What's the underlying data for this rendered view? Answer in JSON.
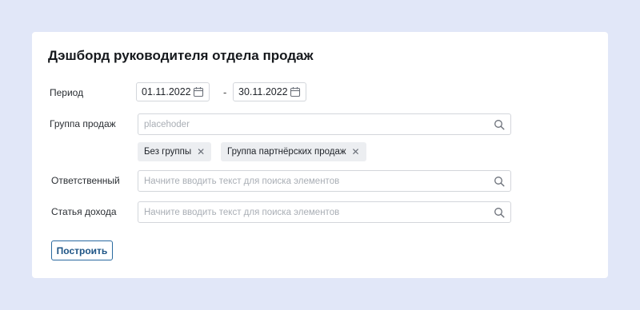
{
  "dashboard": {
    "title": "Дэшборд руководителя отдела продаж"
  },
  "period": {
    "label": "Период",
    "from": "01.11.2022",
    "separator": "-",
    "to": "30.11.2022"
  },
  "sales_group": {
    "label": "Группа продаж",
    "placeholder": "placehoder",
    "chips": [
      {
        "label": "Без группы"
      },
      {
        "label": "Группа партнёрских продаж"
      }
    ],
    "chip_remove_glyph": "✕"
  },
  "responsible": {
    "label": "Ответственный",
    "placeholder": "Начните вводить текст для поиска элементов"
  },
  "income_item": {
    "label": "Статья дохода",
    "placeholder": "Начните вводить текст для поиска элементов"
  },
  "actions": {
    "build_label": "Построить"
  },
  "colors": {
    "background": "#e1e7f8",
    "card": "#ffffff",
    "accent": "#1d5485",
    "chip": "#eceef1"
  },
  "icons": [
    "calendar-icon",
    "search-icon",
    "close-icon"
  ]
}
